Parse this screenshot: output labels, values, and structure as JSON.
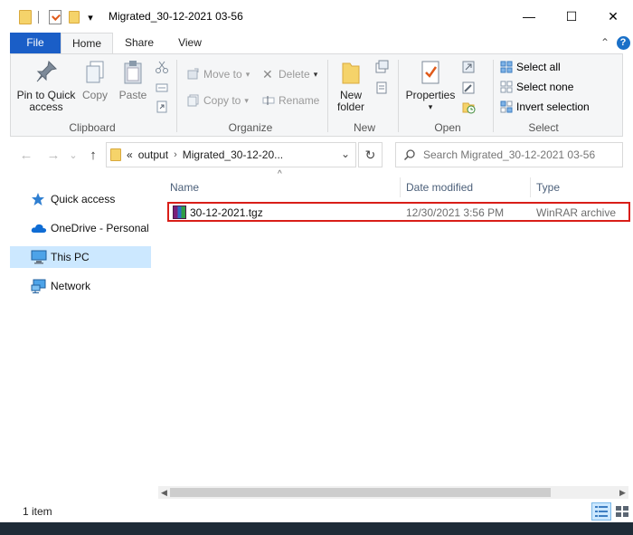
{
  "window": {
    "title": "Migrated_30-12-2021 03-56",
    "minimize_glyph": "—",
    "maximize_glyph": "☐",
    "close_glyph": "✕"
  },
  "quick_access_toolbar": {
    "dropdown_glyph": "▾"
  },
  "ribbon_tabs": {
    "file": "File",
    "home": "Home",
    "share": "Share",
    "view": "View",
    "collapse_glyph": "⌃",
    "help_glyph": "?"
  },
  "ribbon": {
    "clipboard": {
      "label": "Clipboard",
      "pin_label_1": "Pin to Quick",
      "pin_label_2": "access",
      "copy": "Copy",
      "paste": "Paste"
    },
    "organize": {
      "label": "Organize",
      "move_to": "Move to",
      "copy_to": "Copy to",
      "delete": "Delete",
      "rename": "Rename"
    },
    "new": {
      "label": "New",
      "new_folder_1": "New",
      "new_folder_2": "folder"
    },
    "open": {
      "label": "Open",
      "properties": "Properties"
    },
    "select": {
      "label": "Select",
      "select_all": "Select all",
      "select_none": "Select none",
      "invert_selection": "Invert selection"
    }
  },
  "address_bar": {
    "overflow": "«",
    "crumb_1": "output",
    "separator": "›",
    "crumb_2": "Migrated_30-12-20...",
    "dropdown_glyph": "⌄",
    "refresh_glyph": "↻",
    "back_glyph": "←",
    "forward_glyph": "→",
    "history_glyph": "⌄",
    "up_glyph": "↑"
  },
  "search": {
    "placeholder": "Search Migrated_30-12-2021 03-56"
  },
  "nav_pane": {
    "items": [
      {
        "label": "Quick access",
        "icon": "star-icon"
      },
      {
        "label": "OneDrive - Personal",
        "icon": "cloud-icon"
      },
      {
        "label": "This PC",
        "icon": "computer-icon"
      },
      {
        "label": "Network",
        "icon": "network-icon"
      }
    ],
    "selected": "This PC"
  },
  "file_list": {
    "sort_glyph": "^",
    "columns": {
      "name": "Name",
      "date_modified": "Date modified",
      "type": "Type"
    },
    "rows": [
      {
        "name": "30-12-2021.tgz",
        "date_modified": "12/30/2021 3:56 PM",
        "type": "WinRAR archive"
      }
    ]
  },
  "scrollbar": {
    "left_glyph": "◀",
    "right_glyph": "▶"
  },
  "status_bar": {
    "item_count": "1 item"
  },
  "colors": {
    "accent": "#1a5ec7",
    "selection": "#cce8ff",
    "highlight_border": "#d91e18"
  }
}
